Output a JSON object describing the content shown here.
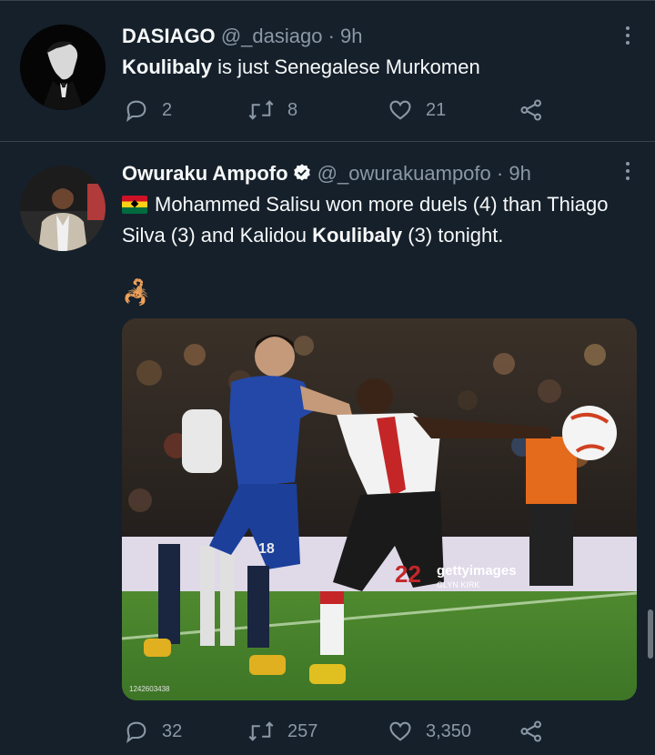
{
  "tweets": [
    {
      "author_name": "DASIAGO",
      "handle": "@_dasiago",
      "separator": "·",
      "time": "9h",
      "text_bold": "Koulibaly",
      "text_rest": " is just Senegalese Murkomen",
      "replies": "2",
      "retweets": "8",
      "likes": "21"
    },
    {
      "author_name": "Owuraku Ampofo",
      "handle": "@_owurakuampofo",
      "separator": "·",
      "time": "9h",
      "flag_icon": "ghana-flag-icon",
      "text_part1": "Mohammed Salisu won more duels (4) than Thiago Silva (3) and Kalidou ",
      "text_bold": "Koulibaly",
      "text_part2": " (3) tonight.",
      "emoji_icon": "scorpion-icon",
      "emoji_glyph": "🦂",
      "image": {
        "watermark": "gettyimages",
        "credit": "GLYN KIRK",
        "image_id": "1242603438",
        "player_number_right": "22",
        "player_number_left": "18"
      },
      "replies": "32",
      "retweets": "257",
      "likes": "3,350"
    }
  ],
  "colors": {
    "background": "#15202b",
    "text_primary": "#f7f9f9",
    "text_secondary": "#8b98a5",
    "verified": "#f7f9f9",
    "divider": "#38444d"
  }
}
